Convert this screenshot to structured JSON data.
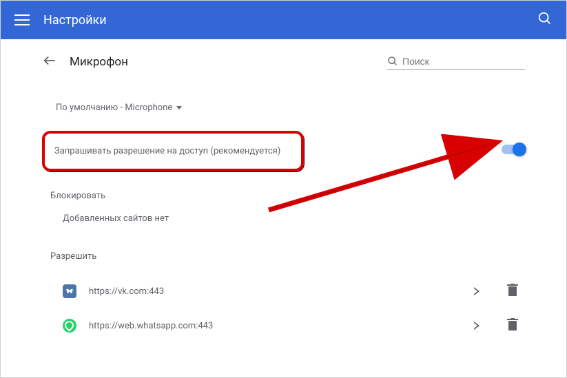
{
  "topbar": {
    "title": "Настройки"
  },
  "header": {
    "page_title": "Микрофон",
    "search_placeholder": "Поиск"
  },
  "dropdown": {
    "label": "По умолчанию - Microphone"
  },
  "main_toggle": {
    "label": "Запрашивать разрешение на доступ (рекомендуется)",
    "enabled": true
  },
  "block_section": {
    "title": "Блокировать",
    "empty_text": "Добавленных сайтов нет"
  },
  "allow_section": {
    "title": "Разрешить",
    "sites": [
      {
        "icon": "vk",
        "url": "https://vk.com:443"
      },
      {
        "icon": "whatsapp",
        "url": "https://web.whatsapp.com:443"
      }
    ]
  }
}
